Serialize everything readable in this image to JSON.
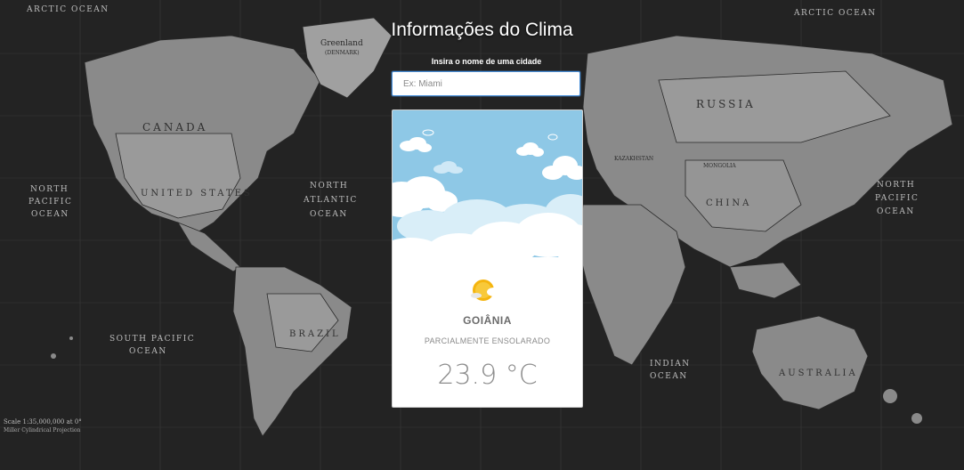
{
  "page": {
    "title": "Informações do Clima",
    "search_label": "Insira o nome de uma cidade",
    "search_placeholder": "Ex: Miami"
  },
  "weather_card": {
    "city": "GOIÂNIA",
    "condition": "PARCIALMENTE ENSOLARADO",
    "temperature": "23.9 °C",
    "icon": "partly-sunny-icon"
  },
  "map_labels": {
    "arctic_ocean_left": "ARCTIC OCEAN",
    "arctic_ocean_right": "ARCTIC OCEAN",
    "greenland": "Greenland",
    "greenland_sub": "(DENMARK)",
    "canada": "CANADA",
    "united_states": "UNITED STATES",
    "russia": "RUSSIA",
    "china": "CHINA",
    "mongolia": "MONGOLIA",
    "kazakhstan": "KAZAKHSTAN",
    "brazil": "BRAZIL",
    "australia": "AUSTRALIA",
    "north_pacific_left_1": "NORTH",
    "north_pacific_left_2": "PACIFIC",
    "north_pacific_left_3": "OCEAN",
    "north_pacific_right_1": "NORTH",
    "north_pacific_right_2": "PACIFIC",
    "north_pacific_right_3": "OCEAN",
    "north_atlantic_1": "NORTH",
    "north_atlantic_2": "ATLANTIC",
    "north_atlantic_3": "OCEAN",
    "south_pacific_1": "SOUTH PACIFIC",
    "south_pacific_2": "OCEAN",
    "indian_1": "INDIAN",
    "indian_2": "OCEAN",
    "scale": "Scale 1:35,000,000 at 0°",
    "projection": "Miller Cylindrical Projection"
  },
  "colors": {
    "background": "#1f1f1f",
    "land": "#8c8c8c",
    "land_dark": "#6e6e6e",
    "sky": "#8ec8e6",
    "search_border": "#4a90d9",
    "sun": "#f5b50f"
  }
}
